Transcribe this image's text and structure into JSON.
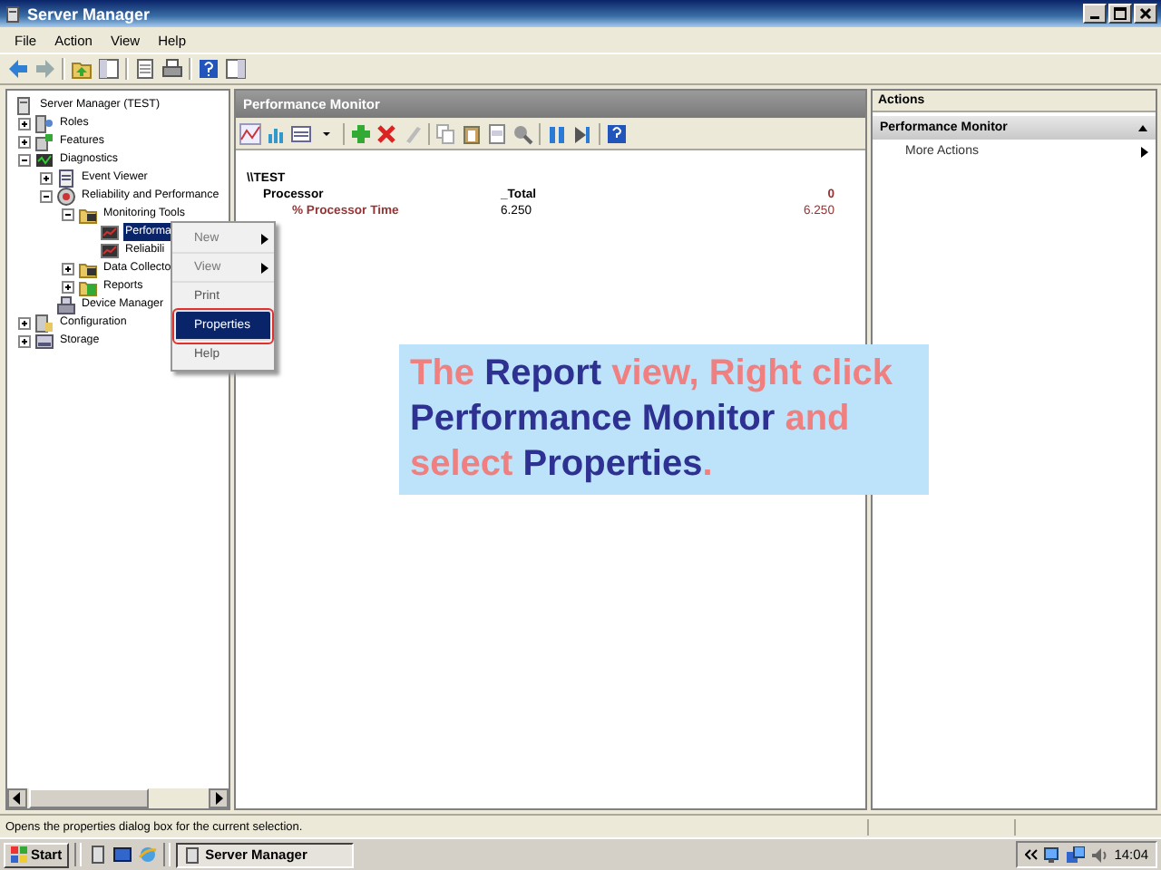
{
  "window": {
    "title": "Server Manager"
  },
  "menu_bar": [
    "File",
    "Action",
    "View",
    "Help"
  ],
  "tree": [
    {
      "label": "Server Manager (TEST)",
      "selected": false,
      "children": [
        {
          "label": "Roles",
          "expanded": false,
          "selected": false
        },
        {
          "label": "Features",
          "expanded": false,
          "selected": false
        },
        {
          "label": "Diagnostics",
          "expanded": true,
          "selected": false,
          "children": [
            {
              "label": "Event Viewer",
              "expanded": false,
              "selected": false
            },
            {
              "label": "Reliability and Performance",
              "expanded": true,
              "selected": false,
              "children": [
                {
                  "label": "Monitoring Tools",
                  "expanded": true,
                  "selected": false,
                  "children": [
                    {
                      "label": "Performa",
                      "selected": true
                    },
                    {
                      "label": "Reliabili",
                      "selected": false
                    }
                  ]
                },
                {
                  "label": "Data Collecto",
                  "expanded": false,
                  "selected": false
                },
                {
                  "label": "Reports",
                  "expanded": false,
                  "selected": false
                }
              ]
            },
            {
              "label": "Device Manager",
              "selected": false
            }
          ]
        },
        {
          "label": "Configuration",
          "expanded": false,
          "selected": false
        },
        {
          "label": "Storage",
          "expanded": false,
          "selected": false
        }
      ]
    }
  ],
  "context_menu": [
    {
      "label": "New",
      "kind": "submenu",
      "selected": false
    },
    {
      "label": "View",
      "kind": "submenu",
      "selected": false
    },
    {
      "label": "Print",
      "kind": "command",
      "selected": false
    },
    {
      "label": "Properties",
      "kind": "command",
      "selected": true
    },
    {
      "label": "Help",
      "kind": "command",
      "selected": false
    }
  ],
  "center": {
    "title": "Performance Monitor",
    "report": {
      "computer": "\\\\TEST",
      "object": "Processor",
      "instance": "_Total",
      "instance_2": "0",
      "counter": "% Processor Time",
      "value": "6.250",
      "value_2": "6.250"
    }
  },
  "actions": {
    "title": "Actions",
    "section": {
      "title": "Performance Monitor",
      "expanded": true,
      "items": [
        {
          "label": "More Actions",
          "kind": "submenu"
        }
      ]
    }
  },
  "callout": [
    {
      "text": "The ",
      "emphasis": false
    },
    {
      "text": "Report",
      "emphasis": true
    },
    {
      "text": " view, Right click ",
      "emphasis": false
    },
    {
      "text": "Performance Monitor",
      "emphasis": true
    },
    {
      "text": " and select ",
      "emphasis": false
    },
    {
      "text": "Properties",
      "emphasis": true
    },
    {
      "text": ".",
      "emphasis": false
    }
  ],
  "status_bar": "Opens the properties dialog box for the current selection.",
  "taskbar": {
    "start": "Start",
    "tasks": [
      {
        "label": "Server Manager",
        "selected": true
      }
    ],
    "clock": "14:04"
  }
}
